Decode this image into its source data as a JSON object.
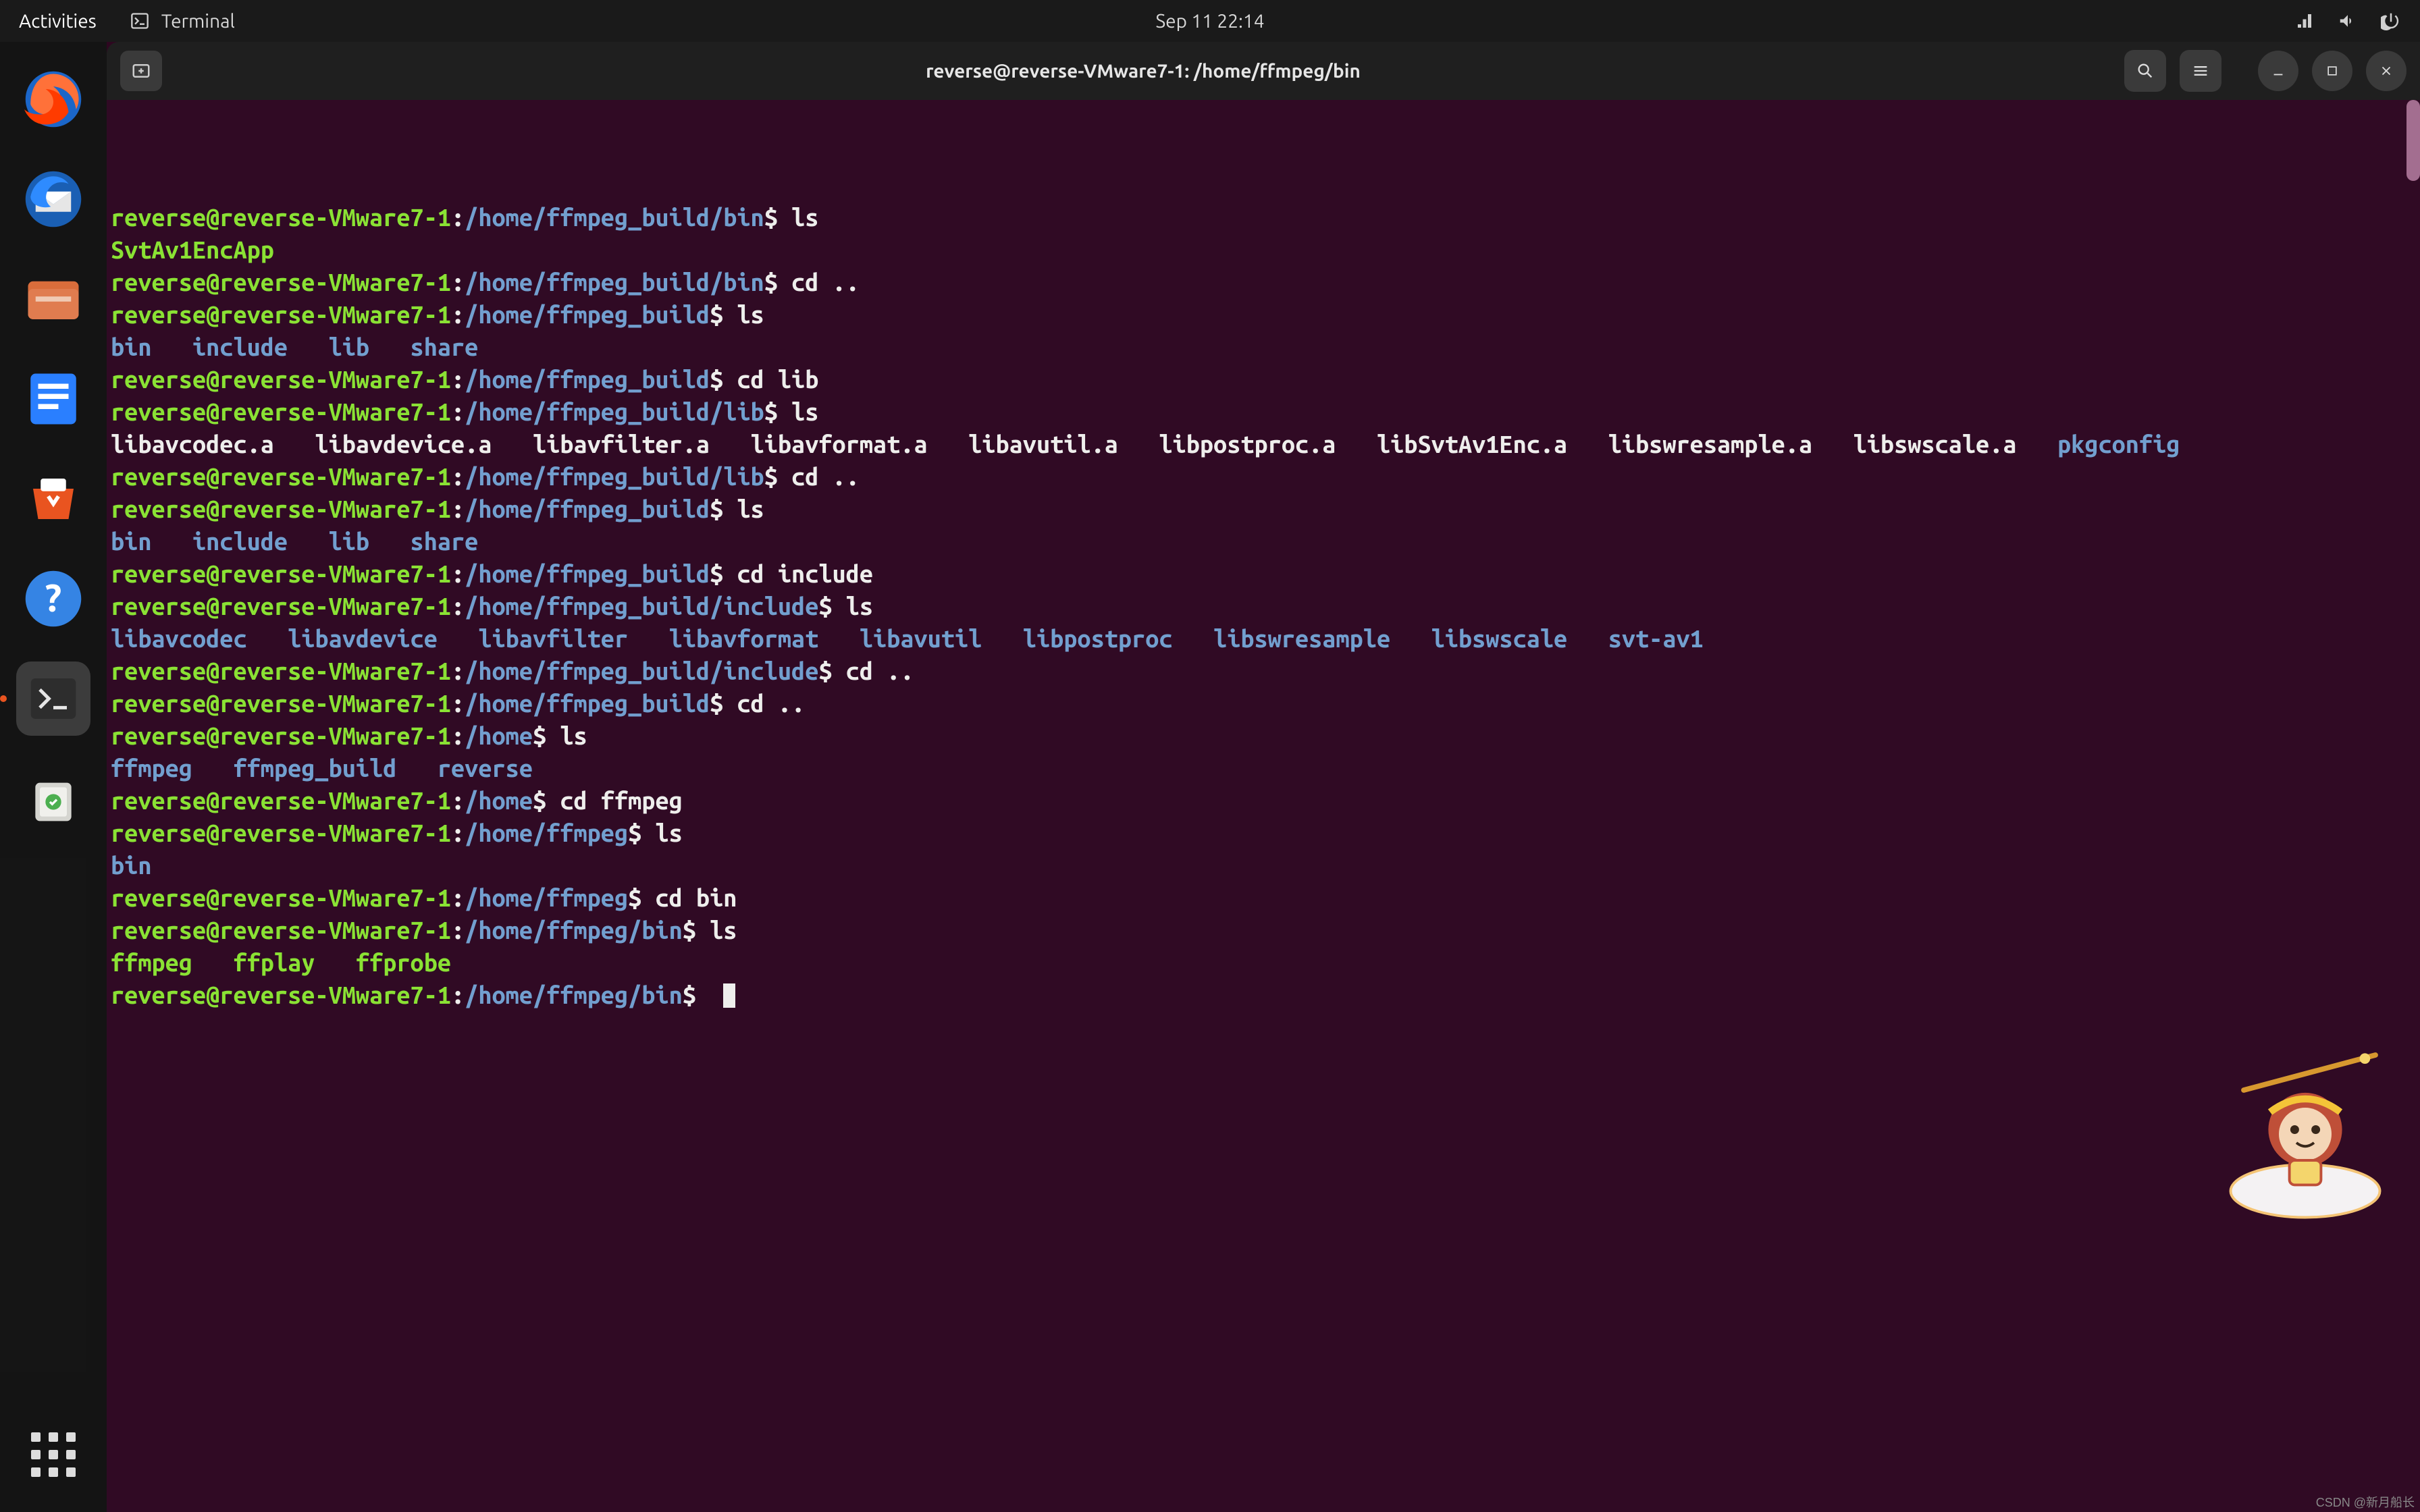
{
  "topbar": {
    "activities": "Activities",
    "app_label": "Terminal",
    "clock": "Sep 11  22:14"
  },
  "window": {
    "title": "reverse@reverse-VMware7-1: /home/ffmpeg/bin"
  },
  "prompt_user": "reverse@reverse-VMware7-1",
  "lines": [
    {
      "path": "/home/ffmpeg_build/bin",
      "cmd": "ls"
    },
    {
      "out_exec": [
        "SvtAv1EncApp"
      ]
    },
    {
      "path": "/home/ffmpeg_build/bin",
      "cmd": "cd .."
    },
    {
      "path": "/home/ffmpeg_build",
      "cmd": "ls"
    },
    {
      "out_dir": [
        "bin",
        "include",
        "lib",
        "share"
      ]
    },
    {
      "path": "/home/ffmpeg_build",
      "cmd": "cd lib"
    },
    {
      "path": "/home/ffmpeg_build/lib",
      "cmd": "ls"
    },
    {
      "out_files": [
        "libavcodec.a",
        "libavdevice.a",
        "libavfilter.a",
        "libavformat.a",
        "libavutil.a",
        "libpostproc.a",
        "libSvtAv1Enc.a",
        "libswresample.a",
        "libswscale.a"
      ],
      "out_trailing_dir": "pkgconfig"
    },
    {
      "path": "/home/ffmpeg_build/lib",
      "cmd": "cd .."
    },
    {
      "path": "/home/ffmpeg_build",
      "cmd": "ls"
    },
    {
      "out_dir": [
        "bin",
        "include",
        "lib",
        "share"
      ]
    },
    {
      "path": "/home/ffmpeg_build",
      "cmd": "cd include"
    },
    {
      "path": "/home/ffmpeg_build/include",
      "cmd": "ls"
    },
    {
      "out_dir": [
        "libavcodec",
        "libavdevice",
        "libavfilter",
        "libavformat",
        "libavutil",
        "libpostproc",
        "libswresample",
        "libswscale",
        "svt-av1"
      ]
    },
    {
      "path": "/home/ffmpeg_build/include",
      "cmd": "cd .."
    },
    {
      "path": "/home/ffmpeg_build",
      "cmd": "cd .."
    },
    {
      "path": "/home",
      "cmd": "ls"
    },
    {
      "out_dir": [
        "ffmpeg",
        "ffmpeg_build",
        "reverse"
      ]
    },
    {
      "path": "/home",
      "cmd": "cd ffmpeg"
    },
    {
      "path": "/home/ffmpeg",
      "cmd": "ls"
    },
    {
      "out_dir": [
        "bin"
      ]
    },
    {
      "path": "/home/ffmpeg",
      "cmd": "cd bin"
    },
    {
      "path": "/home/ffmpeg/bin",
      "cmd": "ls"
    },
    {
      "out_exec": [
        "ffmpeg",
        "ffplay",
        "ffprobe"
      ]
    },
    {
      "path": "/home/ffmpeg/bin",
      "cmd": "",
      "cursor": true
    }
  ],
  "watermark": "CSDN @新月船长"
}
